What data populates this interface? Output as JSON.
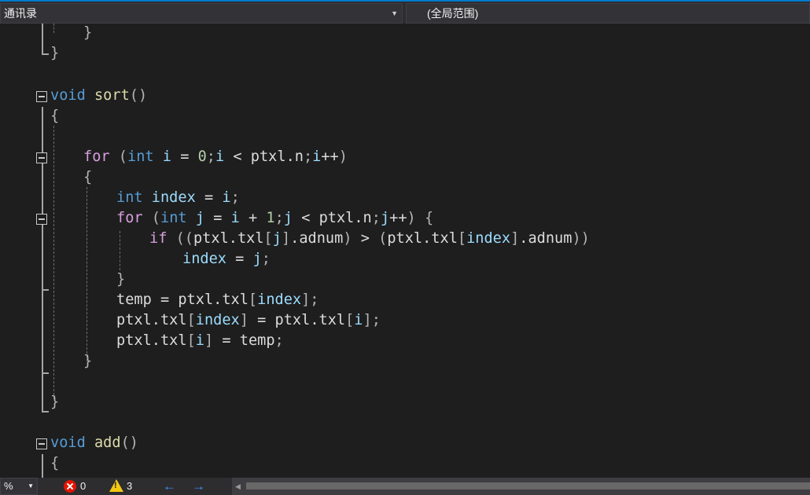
{
  "navbar": {
    "project_combo": "通讯录",
    "scope_combo": "(全局范围)"
  },
  "code_lines": [
    "}",
    "}",
    "",
    "void sort()",
    "{",
    "",
    "for (int i = 0;i < ptxl.n;i++)",
    "{",
    "int index = i;",
    "for (int j = i + 1;j < ptxl.n;j++) {",
    "if ((ptxl.txl[j].adnum) > (ptxl.txl[index].adnum))",
    "index = j;",
    "}",
    "temp = ptxl.txl[index];",
    "ptxl.txl[index] = ptxl.txl[i];",
    "ptxl.txl[i] = temp;",
    "}",
    "",
    "}",
    "",
    "void add()",
    "{"
  ],
  "statusbar": {
    "zoom_value": "%",
    "error_count": "0",
    "warning_count": "3"
  },
  "icons": {
    "error": "error-circle-icon",
    "warning": "warning-triangle-icon",
    "back": "navigate-backward-icon",
    "forward": "navigate-forward-icon",
    "collapse": "collapse-icon"
  }
}
